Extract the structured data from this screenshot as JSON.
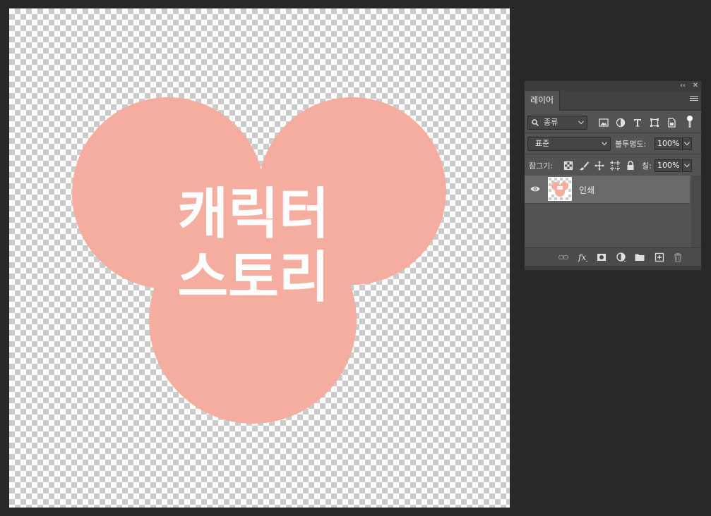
{
  "document": {
    "artwork_text_line1": "캐릭터",
    "artwork_text_line2": "스토리",
    "shape_color": "#f5ada0",
    "text_color": "#ffffff"
  },
  "panel": {
    "collapse_glyph": "‹‹",
    "close_glyph": "✕",
    "tab_label": "레이어",
    "filter": {
      "kind_label": "종류",
      "icons": [
        "image-filter-icon",
        "adjustment-filter-icon",
        "type-filter-icon",
        "shape-filter-icon",
        "smart-object-filter-icon",
        "filter-toggle-icon"
      ]
    },
    "blend_mode": "표준",
    "opacity_label": "불투명도:",
    "opacity_value": "100%",
    "lock_label": "잠그기:",
    "lock_icons": [
      "lock-transparent-icon",
      "lock-paint-icon",
      "lock-position-icon",
      "lock-artboard-icon",
      "lock-all-icon"
    ],
    "fill_label": "칠:",
    "fill_value": "100%",
    "layers": [
      {
        "name": "인쇄",
        "visible": true,
        "selected": true
      }
    ],
    "footer_icons": [
      "link-layers-icon",
      "fx-icon",
      "add-mask-icon",
      "adjustment-layer-icon",
      "new-group-icon",
      "new-layer-icon",
      "delete-layer-icon"
    ],
    "colors": {
      "panel_bg": "#535353",
      "selected_row": "#6a6a6a",
      "dark_bar": "#3c3c3c"
    }
  }
}
